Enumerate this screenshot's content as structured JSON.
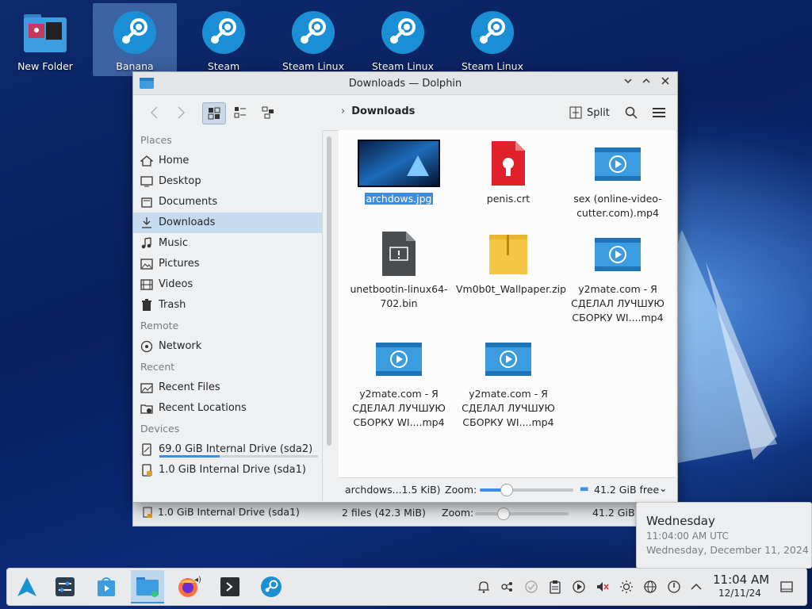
{
  "desktop": {
    "icons": [
      {
        "label": "New Folder"
      },
      {
        "label": "Banana"
      },
      {
        "label": "Steam"
      },
      {
        "label": "Steam Linux"
      },
      {
        "label": "Steam Linux"
      },
      {
        "label": "Steam Linux"
      }
    ]
  },
  "window": {
    "title": "Downloads — Dolphin",
    "breadcrumb": "Downloads",
    "split_label": "Split"
  },
  "sidebar": {
    "places_header": "Places",
    "places": [
      "Home",
      "Desktop",
      "Documents",
      "Downloads",
      "Music",
      "Pictures",
      "Videos",
      "Trash"
    ],
    "remote_header": "Remote",
    "remote": [
      "Network"
    ],
    "recent_header": "Recent",
    "recent": [
      "Recent Files",
      "Recent Locations"
    ],
    "devices_header": "Devices",
    "devices": [
      "69.0 GiB Internal Drive (sda2)",
      "1.0 GiB Internal Drive (sda1)"
    ],
    "device_usage_fraction": 0.38
  },
  "files": [
    {
      "name": "archdows.jpg",
      "type": "image",
      "selected": true
    },
    {
      "name": "penis.crt",
      "type": "certificate"
    },
    {
      "name": "sex (online-video-cutter.com).mp4",
      "type": "video"
    },
    {
      "name": "unetbootin-linux64-702.bin",
      "type": "binary"
    },
    {
      "name": "Vm0b0t_Wallpaper.zip",
      "type": "archive"
    },
    {
      "name": "y2mate.com - Я СДЕЛАЛ ЛУЧШУЮ СБОРКУ WI....mp4",
      "type": "video"
    },
    {
      "name": "y2mate.com - Я СДЕЛАЛ ЛУЧШУЮ СБОРКУ WI....mp4",
      "type": "video"
    },
    {
      "name": "y2mate.com - Я СДЕЛАЛ ЛУЧШУЮ СБОРКУ WI....mp4",
      "type": "video"
    }
  ],
  "statusbar": {
    "selection": "archdows...1.5 KiB)",
    "zoom_label": "Zoom:",
    "zoom_fraction": 0.28,
    "free": "41.2 GiB free"
  },
  "ghost_statusbar": {
    "drive": "1.0 GiB Internal Drive (sda1)",
    "files": "2 files (42.3 MiB)",
    "zoom_label": "Zoom:",
    "free": "41.2 GiB"
  },
  "clock_tooltip": {
    "day": "Wednesday",
    "time": "11:04:00 AM UTC",
    "date": "Wednesday, December 11, 2024"
  },
  "panel": {
    "time": "11:04 AM",
    "date": "12/11/24"
  },
  "colors": {
    "accent": "#3d8ee0",
    "selection_bg": "#c7dbef",
    "steam_blue": "#1a8fd6"
  }
}
